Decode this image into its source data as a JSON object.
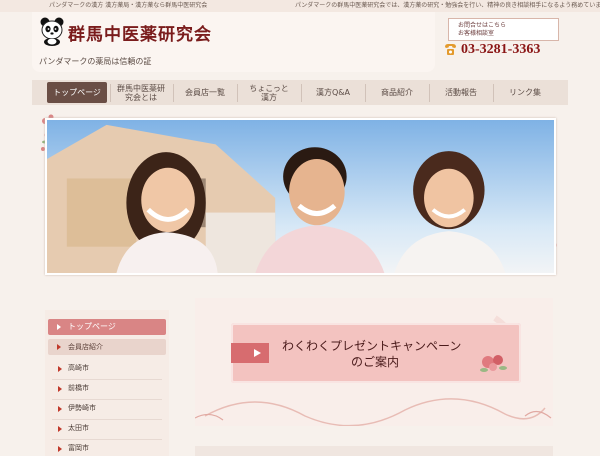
{
  "topbar": {
    "left": "パンダマークの漢方 漢方薬局・漢方薬なら群馬中医研究会",
    "right": "パンダマークの群馬中医薬研究会では、漢方薬の研究・勉強会を行い、精神の良き相談相手になるよう務めています。"
  },
  "header": {
    "title": "群馬中医薬研究会",
    "tagline": "パンダマークの薬局は信頼の証"
  },
  "contact": {
    "line1": "お問合せはこちら",
    "line2": "お客様相談室",
    "phone": "03-3281-3363"
  },
  "nav": {
    "items": [
      {
        "label": "トップページ"
      },
      {
        "label": "群馬中医薬研\n究会とは"
      },
      {
        "label": "会員店一覧"
      },
      {
        "label": "ちょこっと\n漢方"
      },
      {
        "label": "漢方Q&A"
      },
      {
        "label": "商品紹介"
      },
      {
        "label": "活動報告"
      },
      {
        "label": "リンク集"
      }
    ]
  },
  "sidebar": {
    "top": "トップページ",
    "section": "会員店紹介",
    "items": [
      "高崎市",
      "前橋市",
      "伊勢崎市",
      "太田市",
      "富岡市"
    ]
  },
  "campaign": {
    "line1": "わくわくプレゼントキャンペーン",
    "line2": "のご案内"
  },
  "colors": {
    "brand": "#7a1c1c",
    "nav_active": "#6a4e45",
    "accent_pink": "#d98585"
  }
}
